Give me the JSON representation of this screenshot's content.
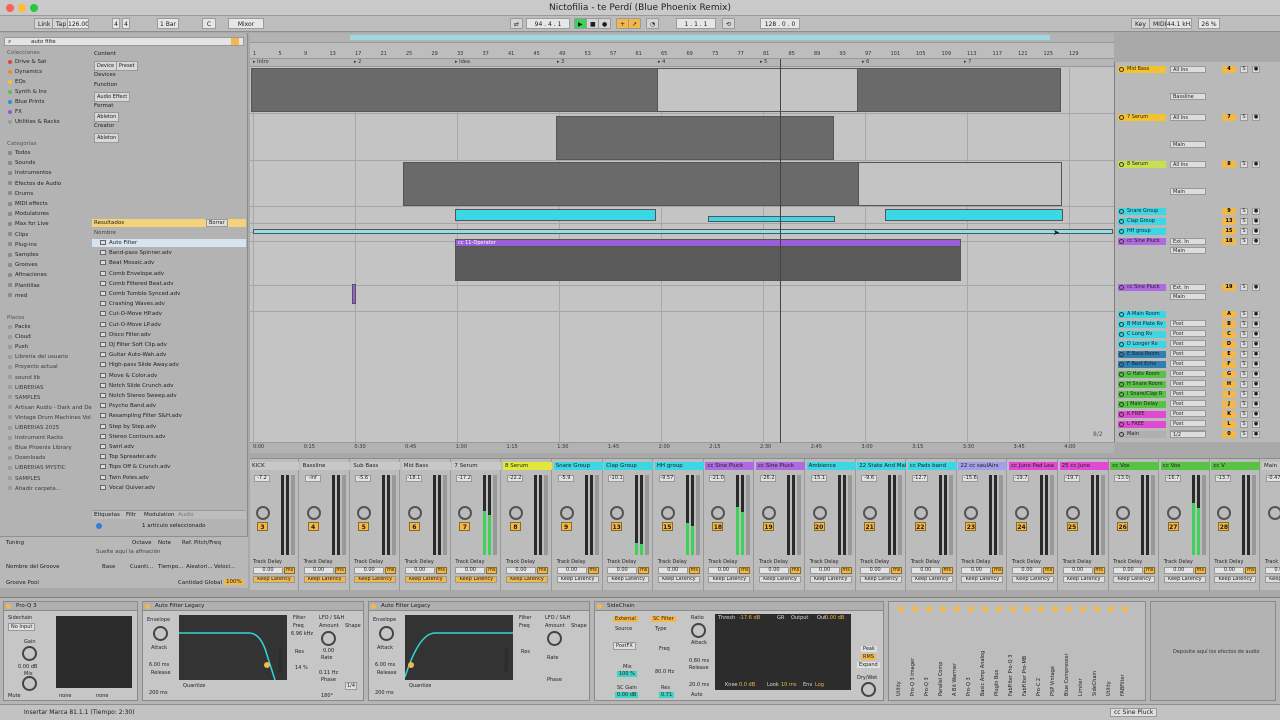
{
  "window": {
    "title": "Nictofilia - te Perdí (Blue Phoenix Remix)",
    "traffic_colors": [
      "#fe5f57",
      "#febc2e",
      "#28c840"
    ]
  },
  "control_bar": {
    "link": "Link",
    "tap": "Tap",
    "tempo": "126.00",
    "time_sig_num": "4",
    "time_sig_den": "4",
    "quantize": "1 Bar",
    "key": "C",
    "scale": "Mixor",
    "position": "94 . 4 . 1",
    "loop_start": "1 . 1 . 1",
    "loop_len": "128 . 0 . 0",
    "key_btn": "Key",
    "midi_btn": "MIDI",
    "sample_rate": "44.1 kHz",
    "cpu": "26 %"
  },
  "browser": {
    "search_value": "auto filte",
    "collections_label": "Colecciones",
    "collections": [
      {
        "label": "Drive & Sat",
        "color": "#e0453a"
      },
      {
        "label": "Dynamics",
        "color": "#f08a2c"
      },
      {
        "label": "EQs",
        "color": "#f2c330"
      },
      {
        "label": "Synth & Ins",
        "color": "#57c244"
      },
      {
        "label": "Blue Prints",
        "color": "#2f8de0"
      },
      {
        "label": "FX",
        "color": "#9a55d4"
      },
      {
        "label": "Utilities & Racks",
        "color": "#9a9a9a"
      }
    ],
    "categories_label": "Categorías",
    "categories": [
      "Todos",
      "Sounds",
      "Instrumentos",
      "Efectos de Audio",
      "Drums",
      "MIDI effects",
      "Modulatores",
      "Max for Live",
      "Clips",
      "Plug-ins",
      "Samples",
      "Grooves",
      "Afinaciones",
      "Plantillas",
      "med"
    ],
    "places_label": "Places",
    "places": [
      "Packs",
      "Cloud",
      "Push",
      "Librería del usuario",
      "Proyecto actual",
      "sound lib",
      "LIBRERIAS",
      "SAMPLES",
      "Artisan Audio - Dark and De",
      "Vintage Drum Machines Vol",
      "LIBRERIAS 2025",
      "Instrument Racks",
      "Blue Phoenix Library",
      "Downloads",
      "LIBRERIAS MYSTIC",
      "SAMPLES",
      "Añadir carpeta..."
    ],
    "filters": {
      "content_label": "Content",
      "content_values": [
        "Device",
        "Preset"
      ],
      "devices_label": "Devices",
      "function_label": "Function",
      "function_values": [
        "Audio Effect"
      ],
      "format_label": "Format",
      "format_values": [
        "Ableton"
      ],
      "creator_label": "Creator",
      "creator_values": [
        "Ableton"
      ]
    },
    "results_label": "Resultados",
    "clear_label": "Borrar",
    "name_header": "Nombre",
    "results": [
      "Auto Filter",
      "Band-pass Spinner.adv",
      "Beat Mosaic.adv",
      "Comb Envelope.adv",
      "Comb Filtered Beat.adv",
      "Comb Tumble Synced.adv",
      "Crashing Waves.adv",
      "Cut-O-Move HP.adv",
      "Cut-O-Move LP.adv",
      "Disco Filter.adv",
      "DJ Filter Soft Clip.adv",
      "Guitar Auto-Wah.adv",
      "High-pass Slide Away.adv",
      "Move & Color.adv",
      "Notch Slide Crunch.adv",
      "Notch Stereo Sweep.adv",
      "Psycho Band.adv",
      "Resampling Filter S&H.adv",
      "Step by Step.adv",
      "Stereo Contours.adv",
      "Swirl.adv",
      "Top Spreader.adv",
      "Tops Off & Crunch.adv",
      "Twin Poles.adv",
      "Vocal Quiver.adv"
    ],
    "tabs": [
      "Etiquetas",
      "Filtr",
      "Modulation",
      "Audio"
    ],
    "selection_info": "1 artículo seleccionado",
    "groove": {
      "tuning": "Tuning",
      "octave": "Octave",
      "note": "Note",
      "ref_pitch": "Ref. Pitch/Freq",
      "drop_hint": "Suelte aquí la afinación",
      "groove_name": "Nombre del Groove",
      "base": "Base",
      "quantize": "Cuanti...",
      "timing": "Tiempo...",
      "random": "Aleatori...",
      "velocity": "Veloci...",
      "groove_pool": "Groove Pool",
      "global_amount": "Cantidad Global",
      "global_value": "100%"
    }
  },
  "arrangement": {
    "ruler_ticks": [
      "1",
      "5",
      "9",
      "13",
      "17",
      "21",
      "25",
      "29",
      "33",
      "37",
      "41",
      "45",
      "49",
      "53",
      "57",
      "61",
      "65",
      "69",
      "73",
      "77",
      "81",
      "85",
      "89",
      "93",
      "97",
      "101",
      "105",
      "109",
      "113",
      "117",
      "121",
      "125",
      "129"
    ],
    "markers": [
      "Intro",
      "2",
      "Idea",
      "3",
      "4",
      "5",
      "6",
      "7"
    ],
    "time_ticks": [
      "0:00",
      "0:15",
      "0:30",
      "0:45",
      "1:00",
      "1:15",
      "1:30",
      "1:45",
      "2:00",
      "2:15",
      "2:30",
      "2:45",
      "3:00",
      "3:15",
      "3:30",
      "3:45",
      "4:00"
    ],
    "clip_label": "cc 11-Operator",
    "zoom_indicator": "8/2"
  },
  "tracks": [
    {
      "name": "Mid Bass",
      "color": "#f2c330",
      "num": "4",
      "in": "All Ins",
      "ch": "All Channe",
      "mode": "In Auto Off",
      "out": "Bassline"
    },
    {
      "name": "7 Serum",
      "color": "#f2c330",
      "num": "7",
      "in": "All Ins",
      "ch": "All Channe",
      "mode": "In Auto Off",
      "out": "Main"
    },
    {
      "name": "8 Serum",
      "color": "#c8e04a",
      "num": "8",
      "in": "All Ins",
      "ch": "All Channe",
      "mode": "In Auto Off",
      "out": "Main"
    },
    {
      "name": "Snare Group",
      "color": "#3cd7e5",
      "num": "9",
      "in": "",
      "ch": "",
      "mode": "",
      "out": ""
    },
    {
      "name": "Clap Group",
      "color": "#3cd7e5",
      "num": "13",
      "in": "",
      "ch": "",
      "mode": "",
      "out": ""
    },
    {
      "name": "HH group",
      "color": "#3cd7e5",
      "num": "15",
      "in": "",
      "ch": "",
      "mode": "",
      "out": ""
    },
    {
      "name": "cc Sine Pluck",
      "color": "#b06ae0",
      "num": "18",
      "in": "Ext. In",
      "ch": "",
      "mode": "In Auto Off",
      "out": "Main"
    },
    {
      "name": "cc Sine Pluck",
      "color": "#b06ae0",
      "num": "19",
      "in": "Ext. In",
      "ch": "",
      "mode": "",
      "out": "Main"
    },
    {
      "name": "A Main Room",
      "color": "#3cd7e5",
      "num": "A",
      "in": "",
      "ch": "",
      "mode": "",
      "out": "Post"
    },
    {
      "name": "B Mid Plate Rv",
      "color": "#3cd7e5",
      "num": "B",
      "in": "",
      "ch": "",
      "mode": "",
      "out": "Post"
    },
    {
      "name": "C Long Rv",
      "color": "#3cd7e5",
      "num": "C",
      "in": "",
      "ch": "",
      "mode": "",
      "out": "Post"
    },
    {
      "name": "D Longer Rv",
      "color": "#3cd7e5",
      "num": "D",
      "in": "",
      "ch": "",
      "mode": "",
      "out": "Post"
    },
    {
      "name": "E Bass Room",
      "color": "#2f7fb0",
      "num": "E",
      "in": "",
      "ch": "",
      "mode": "",
      "out": "Post"
    },
    {
      "name": "F Best Echo",
      "color": "#2f7fb0",
      "num": "F",
      "in": "",
      "ch": "",
      "mode": "",
      "out": "Post"
    },
    {
      "name": "G Hats Room",
      "color": "#57c244",
      "num": "G",
      "in": "",
      "ch": "",
      "mode": "",
      "out": "Post"
    },
    {
      "name": "H Snare Room",
      "color": "#57c244",
      "num": "H",
      "in": "",
      "ch": "",
      "mode": "",
      "out": "Post"
    },
    {
      "name": "I Snare/Clap R",
      "color": "#57c244",
      "num": "I",
      "in": "",
      "ch": "",
      "mode": "",
      "out": "Post"
    },
    {
      "name": "J Main Delay",
      "color": "#57c244",
      "num": "J",
      "in": "",
      "ch": "",
      "mode": "",
      "out": "Post"
    },
    {
      "name": "K FREE",
      "color": "#e04ad2",
      "num": "K",
      "in": "",
      "ch": "",
      "mode": "",
      "out": "Post"
    },
    {
      "name": "L FREE",
      "color": "#e04ad2",
      "num": "L",
      "in": "",
      "ch": "",
      "mode": "",
      "out": "Post"
    },
    {
      "name": "Main",
      "color": "#b0b0b0",
      "num": "0",
      "in": "1/2",
      "ch": "",
      "mode": "",
      "out": ""
    }
  ],
  "mixer": {
    "strips": [
      {
        "name": "KICK",
        "color": "#c8c8c8",
        "num": "3",
        "vol": "-7.2",
        "meter": 0.0
      },
      {
        "name": "Bassline",
        "color": "#c8c8c8",
        "num": "4",
        "vol": "-inf",
        "meter": 0.0
      },
      {
        "name": "Sub Bass",
        "color": "#c8c8c8",
        "num": "5",
        "vol": "-5.6",
        "meter": 0.0
      },
      {
        "name": "Mid Bass",
        "color": "#c8c8c8",
        "num": "6",
        "vol": "-18.1",
        "meter": 0.0
      },
      {
        "name": "7 Serum",
        "color": "#c8c8c8",
        "num": "7",
        "vol": "-17.2",
        "meter": 0.55
      },
      {
        "name": "8 Serum",
        "color": "#e0e83a",
        "num": "8",
        "vol": "-22.2",
        "meter": 0.0
      },
      {
        "name": "Snare Group",
        "color": "#3cd7e5",
        "num": "9",
        "vol": "-5.9",
        "meter": 0.0
      },
      {
        "name": "Clap Group",
        "color": "#3cd7e5",
        "num": "13",
        "vol": "-10.1",
        "meter": 0.15
      },
      {
        "name": "HH group",
        "color": "#3cd7e5",
        "num": "15",
        "vol": "-9.57",
        "meter": 0.4
      },
      {
        "name": "cc Sine Pluck",
        "color": "#b06ae0",
        "num": "18",
        "vol": "-21.0",
        "meter": 0.6
      },
      {
        "name": "cc Sine Pluck",
        "color": "#b06ae0",
        "num": "19",
        "vol": "-26.2",
        "meter": 0.0
      },
      {
        "name": "Ambience",
        "color": "#3cd7e5",
        "num": "20",
        "vol": "-15.1",
        "meter": 0.0
      },
      {
        "name": "22 State And Mal",
        "color": "#3cd7e5",
        "num": "21",
        "vol": "-9.6",
        "meter": 0.0
      },
      {
        "name": "cc Pads band",
        "color": "#3cd7e5",
        "num": "22",
        "vol": "-12.7",
        "meter": 0.0
      },
      {
        "name": "22 cc saulAirs",
        "color": "#a0a0e8",
        "num": "23",
        "vol": "-15.6",
        "meter": 0.0
      },
      {
        "name": "cc Juno Pad Lea",
        "color": "#e04ad2",
        "num": "24",
        "vol": "-19.7",
        "meter": 0.0
      },
      {
        "name": "25 cc Juno",
        "color": "#e04ad2",
        "num": "25",
        "vol": "-19.7",
        "meter": 0.0
      },
      {
        "name": "cc Vox",
        "color": "#57c244",
        "num": "26",
        "vol": "-13.0",
        "meter": 0.0
      },
      {
        "name": "cc Vox",
        "color": "#57c244",
        "num": "27",
        "vol": "-16.7",
        "meter": 0.65
      },
      {
        "name": "cc V",
        "color": "#57c244",
        "num": "28",
        "vol": "-13.7",
        "meter": 0.0
      },
      {
        "name": "Main",
        "color": "#c8c8c8",
        "num": "",
        "vol": "-0.47",
        "meter": 0.4
      }
    ],
    "delay_label": "Track Delay",
    "delay_value": "0.00",
    "ms_label": "ms",
    "keep_label": "Keep Latency"
  },
  "devices": {
    "proq_title": "Pro-Q 3",
    "proq": {
      "sidechain": "Sidechain",
      "input": "No Input",
      "gain": "Gain",
      "gain_value": "0.00 dB",
      "mix": "Mix",
      "mix_value": "100.00 %",
      "mute": "Mute",
      "none": "none"
    },
    "af1_title": "Auto Filter Legacy",
    "af2_title": "Auto Filter Legacy",
    "af": {
      "envelope": "Envelope",
      "attack": "Attack",
      "attack_value": "6.00 ms",
      "release": "Release",
      "release_value": "200 ms",
      "filter": "Filter",
      "freq": "Freq",
      "freq_value": "6.96 kHz",
      "res": "Res",
      "res_value": "14 %",
      "lfo": "LFO / S&H",
      "amount": "Amount",
      "amount_value": "0.00",
      "rate": "Rate",
      "rate_value": "0.11 Hz",
      "shape": "Shape",
      "phase": "Phase",
      "phase_value": "180°",
      "quantize": "Quantize",
      "beat": "1/4",
      "sidechain": "Sidechain"
    },
    "sc_title": "SideChain",
    "sc": {
      "external": "External",
      "sc_filter": "SC Filter",
      "source": "Source",
      "source_value": "PostFX",
      "mix": "Mix",
      "mix_value": "100 %",
      "sc_gain": "SC Gain",
      "sc_gain_value": "0.00 dB",
      "freq": "Freq",
      "freq_value": "80.0 Hz",
      "res": "Res",
      "res_value": "0.71",
      "ratio": "Ratio",
      "attack": "Attack",
      "attack_value": "0.80 ms",
      "release": "Release",
      "release_value": "20.0 ms",
      "auto": "Auto",
      "thresh": "Thresh",
      "thresh_value": "-17.6 dB",
      "gr": "GR",
      "output": "Output",
      "out": "Out",
      "out_value": "0.00 dB",
      "knee": "Knee",
      "knee_value": "0.0 dB",
      "look": "Look",
      "look_value": "10 ms",
      "env": "Env",
      "env_value": "Log",
      "peak": "Peak",
      "rms": "RMS",
      "expand": "Expand",
      "drywet": "Dry/Wet"
    },
    "drop_hint": "Deposite aquí los efectos de audio",
    "chain_labels": [
      "Utility",
      "Pro-Q 3 Imager",
      "Pro-Q 3",
      "Parallel Comp",
      "A Bit Warmer",
      "Pro-Q 3",
      "Basic Amp Analog",
      "PlugIn Bus",
      "FabFilter Pro-Q 3",
      "FabFilter Pro-MB",
      "Pro-C 2",
      "PSP Vintage",
      "Blue Compressor",
      "Limiter",
      "SideChain",
      "Utility",
      "FABFilter"
    ]
  },
  "status": {
    "text": "Insertar Marca 81.1.1 (Tiempo: 2:30)",
    "track": "cc Sine Pluck"
  }
}
